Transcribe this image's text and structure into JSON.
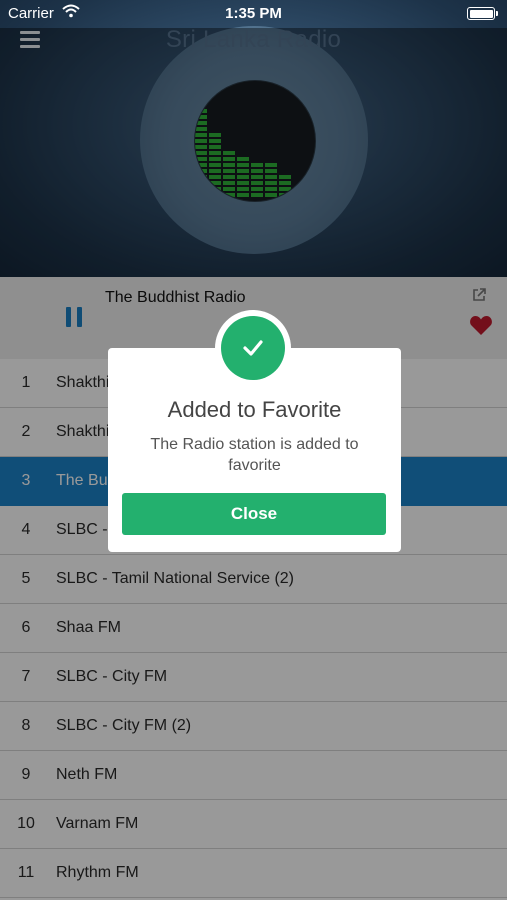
{
  "status": {
    "carrier": "Carrier",
    "time": "1:35 PM"
  },
  "header": {
    "title": "Sri Lanka Radio"
  },
  "player": {
    "now_playing": "The Buddhist Radio"
  },
  "stations": [
    {
      "num": "1",
      "name": "Shakthi FM"
    },
    {
      "num": "2",
      "name": "Shakthi FM (2)"
    },
    {
      "num": "3",
      "name": "The Buddhist Radio"
    },
    {
      "num": "4",
      "name": "SLBC - Tamil National Service"
    },
    {
      "num": "5",
      "name": "SLBC - Tamil National Service (2)"
    },
    {
      "num": "6",
      "name": "Shaa FM"
    },
    {
      "num": "7",
      "name": "SLBC - City FM"
    },
    {
      "num": "8",
      "name": "SLBC - City FM (2)"
    },
    {
      "num": "9",
      "name": "Neth FM"
    },
    {
      "num": "10",
      "name": "Varnam FM"
    },
    {
      "num": "11",
      "name": "Rhythm FM"
    }
  ],
  "selected_station_index": 2,
  "dialog": {
    "title": "Added to Favorite",
    "message": "The Radio station is added to favorite",
    "close_label": "Close"
  },
  "colors": {
    "accent": "#1b82c9",
    "success": "#23b06e",
    "heart": "#c0192e"
  },
  "icons": [
    "menu-icon",
    "share-icon",
    "heart-icon",
    "pause-icon",
    "checkmark-icon",
    "wifi-icon",
    "battery-icon"
  ]
}
